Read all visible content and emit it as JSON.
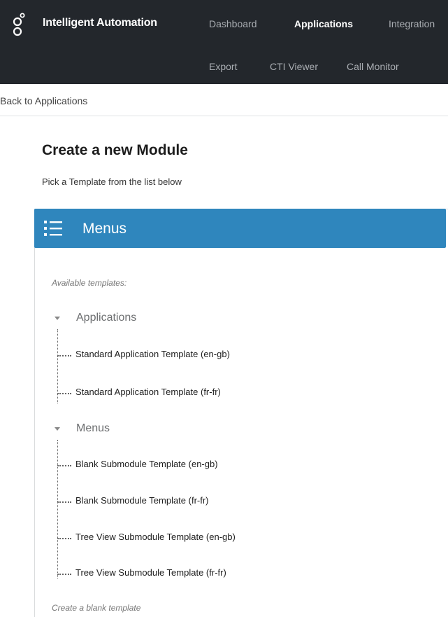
{
  "header": {
    "brand": "Intelligent Automation",
    "nav_primary": [
      {
        "label": "Dashboard",
        "active": false
      },
      {
        "label": "Applications",
        "active": true
      },
      {
        "label": "Integration",
        "active": false
      }
    ],
    "nav_secondary": [
      {
        "label": "Export"
      },
      {
        "label": "CTI Viewer"
      },
      {
        "label": "Call Monitor"
      }
    ]
  },
  "breadcrumb": {
    "back_label": "Back to Applications"
  },
  "page": {
    "title": "Create a new Module",
    "subtitle": "Pick a Template from the list below"
  },
  "panel": {
    "title": "Menus",
    "icon": "list-icon",
    "accent_color": "#2f86bd",
    "caption": "Available templates:",
    "groups": [
      {
        "label": "Applications",
        "expanded": true,
        "items": [
          "Standard Application Template (en-gb)",
          "Standard Application Template (fr-fr)"
        ]
      },
      {
        "label": "Menus",
        "expanded": true,
        "items": [
          "Blank Submodule Template (en-gb)",
          "Blank Submodule Template (fr-fr)",
          "Tree View Submodule Template (en-gb)",
          "Tree View Submodule Template (fr-fr)"
        ]
      }
    ],
    "footer_link": "Create a blank template"
  }
}
